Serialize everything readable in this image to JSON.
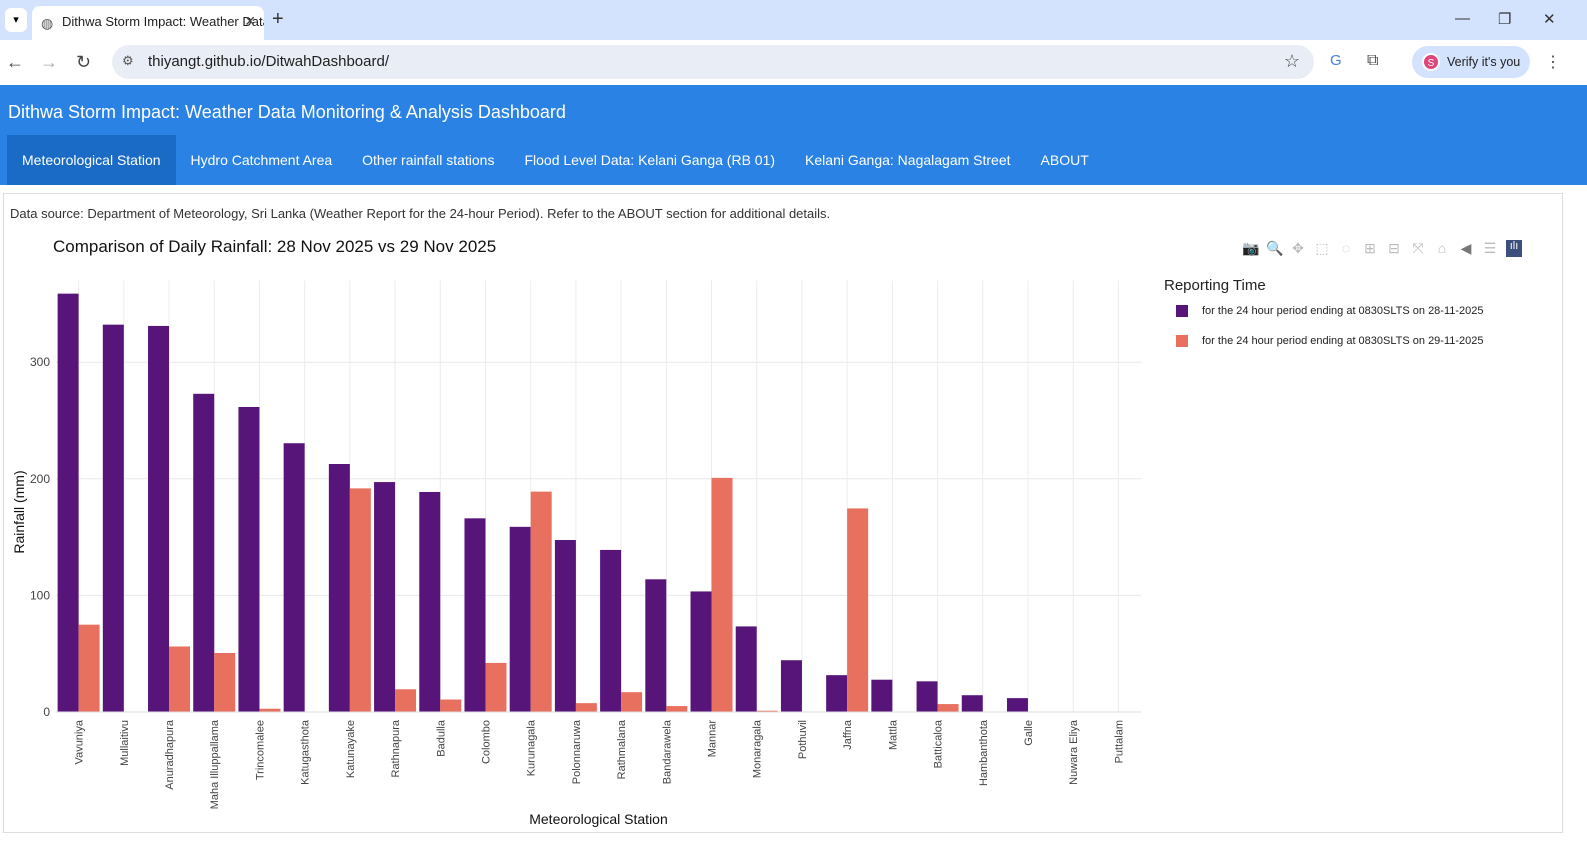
{
  "browser": {
    "tab_title": "Dithwa Storm Impact: Weather Data Monitoring & Analysis Dashboard",
    "url": "thiyangt.github.io/DitwahDashboard/",
    "profile_label": "Verify it's you",
    "profile_initial": "S"
  },
  "header": {
    "title": "Dithwa Storm Impact: Weather Data Monitoring & Analysis Dashboard",
    "tabs": [
      {
        "label": "Meteorological Station",
        "active": true
      },
      {
        "label": "Hydro Catchment Area"
      },
      {
        "label": "Other rainfall stations"
      },
      {
        "label": "Flood Level Data: Kelani Ganga (RB 01)"
      },
      {
        "label": "Kelani Ganga: Nagalagam Street"
      },
      {
        "label": "ABOUT"
      }
    ]
  },
  "source_note": "Data source: Department of Meteorology, Sri Lanka (Weather Report for the 24-hour Period). Refer to the ABOUT section for additional details.",
  "toolbar": [
    "camera-icon",
    "zoom-icon",
    "pan-icon",
    "box-select-icon",
    "lasso-icon",
    "zoom-in-icon",
    "zoom-out-icon",
    "autoscale-icon",
    "reset-axes-icon",
    "hover-closest-icon",
    "hover-compare-icon",
    "plotly-logo-icon"
  ],
  "chart_data": {
    "type": "bar",
    "title": "Comparison of Daily Rainfall: 28 Nov 2025 vs 29 Nov 2025",
    "xlabel": "Meteorological Station",
    "ylabel": "Rainfall (mm)",
    "ylim": [
      0,
      370
    ],
    "yticks": [
      0,
      100,
      200,
      300
    ],
    "grid": true,
    "legend_position": "right",
    "legend_title": "Reporting Time",
    "categories": [
      "Vavuniya",
      "Mullaitivu",
      "Anuradhapura",
      "Maha Illuppallama",
      "Trincomalee",
      "Katugasthota",
      "Katunayake",
      "Rathnapura",
      "Badulla",
      "Colombo",
      "Kurunagala",
      "Polonnaruwa",
      "Rathmalana",
      "Bandarawela",
      "Mannar",
      "Monaragala",
      "Pothuvil",
      "Jaffna",
      "Mattla",
      "Batticaloa",
      "Hambanthota",
      "Galle",
      "Nuwara Eliya",
      "Puttalam"
    ],
    "series": [
      {
        "name": "for the 24 hour period ending at 0830SLTS on 28-11-2025",
        "color": "#57157a",
        "values": [
          358.8,
          332.2,
          331.1,
          272.9,
          261.6,
          230.5,
          212.7,
          197.2,
          188.7,
          166.1,
          158.8,
          147.5,
          139.0,
          113.8,
          103.4,
          73.4,
          44.4,
          31.6,
          27.7,
          26.3,
          14.4,
          11.9,
          0,
          0
        ]
      },
      {
        "name": "for the 24 hour period ending at 0830SLTS on 29-11-2025",
        "color": "#e8705e",
        "values": [
          74.9,
          0,
          56.2,
          50.6,
          2.8,
          0,
          191.8,
          19.5,
          10.7,
          42.1,
          189.0,
          7.6,
          17.0,
          5.1,
          200.8,
          1.1,
          0,
          174.6,
          0.2,
          6.8,
          0,
          0.3,
          0,
          0
        ]
      }
    ]
  }
}
